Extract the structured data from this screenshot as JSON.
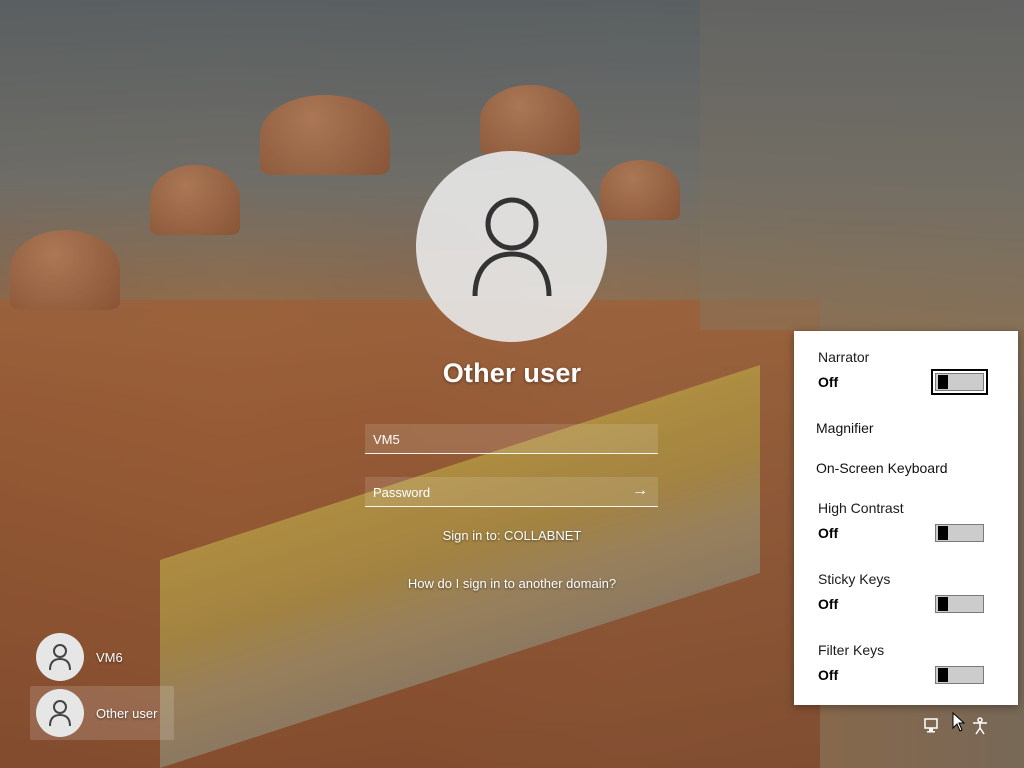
{
  "login": {
    "title": "Other user",
    "username_value": "VM5",
    "password_placeholder": "Password",
    "submit_arrow": "→",
    "sign_in_to": "Sign in to: COLLABNET",
    "domain_help_link": "How do I sign in to another domain?"
  },
  "users": [
    {
      "name": "VM6",
      "selected": false
    },
    {
      "name": "Other user",
      "selected": true
    }
  ],
  "accessibility": {
    "items": [
      {
        "label": "Narrator",
        "state": "Off",
        "type": "toggle"
      },
      {
        "label": "Magnifier",
        "type": "link"
      },
      {
        "label": "On-Screen Keyboard",
        "type": "link"
      },
      {
        "label": "High Contrast",
        "state": "Off",
        "type": "toggle"
      },
      {
        "label": "Sticky Keys",
        "state": "Off",
        "type": "toggle"
      },
      {
        "label": "Filter Keys",
        "state": "Off",
        "type": "toggle"
      }
    ]
  },
  "tray": {
    "icons": [
      "network-icon",
      "accessibility-icon"
    ]
  },
  "colors": {
    "panel_bg": "#ffffff",
    "toggle_knob": "#000000",
    "toggle_track": "#cccccc"
  }
}
